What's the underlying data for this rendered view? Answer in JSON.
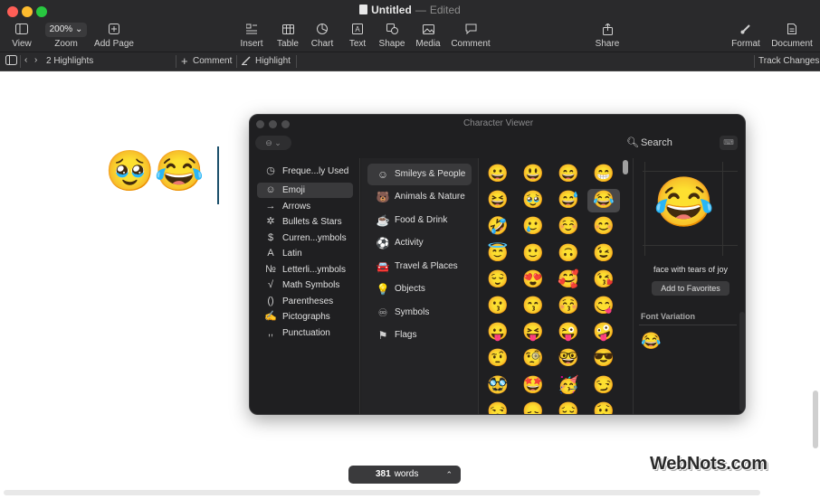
{
  "window": {
    "title": "Untitled",
    "title_sep": "—",
    "status": "Edited"
  },
  "toolbar": {
    "view": "View",
    "zoom_value": "200% ⌄",
    "zoom": "Zoom",
    "add_page": "Add Page",
    "insert": "Insert",
    "table": "Table",
    "chart": "Chart",
    "text": "Text",
    "shape": "Shape",
    "media": "Media",
    "comment": "Comment",
    "share": "Share",
    "format": "Format",
    "document": "Document"
  },
  "formatbar": {
    "highlights": "2 Highlights",
    "comment": "Comment",
    "highlight": "Highlight",
    "track_changes": "Track Changes"
  },
  "document": {
    "emoji_text": "🥹😂",
    "word_count": "381",
    "word_label": "words",
    "watermark": "WebNots.com"
  },
  "character_viewer": {
    "title": "Character Viewer",
    "search": "Search",
    "categories": [
      {
        "icon": "◷",
        "label": "Freque...ly Used"
      },
      {
        "icon": "☺",
        "label": "Emoji"
      },
      {
        "icon": "→",
        "label": "Arrows"
      },
      {
        "icon": "✲",
        "label": "Bullets & Stars"
      },
      {
        "icon": "$",
        "label": "Curren...ymbols"
      },
      {
        "icon": "A",
        "label": "Latin"
      },
      {
        "icon": "№",
        "label": "Letterli...ymbols"
      },
      {
        "icon": "√",
        "label": "Math Symbols"
      },
      {
        "icon": "()",
        "label": "Parentheses"
      },
      {
        "icon": "✍",
        "label": "Pictographs"
      },
      {
        "icon": ",,",
        "label": "Punctuation"
      }
    ],
    "emoji_categories": [
      {
        "icon": "☺",
        "label": "Smileys & People"
      },
      {
        "icon": "🐻",
        "label": "Animals & Nature"
      },
      {
        "icon": "☕",
        "label": "Food & Drink"
      },
      {
        "icon": "⚽",
        "label": "Activity"
      },
      {
        "icon": "🚘",
        "label": "Travel & Places"
      },
      {
        "icon": "💡",
        "label": "Objects"
      },
      {
        "icon": "♾",
        "label": "Symbols"
      },
      {
        "icon": "⚑",
        "label": "Flags"
      }
    ],
    "emoji_grid": [
      [
        "😀",
        "😃",
        "😄",
        "😁"
      ],
      [
        "😆",
        "🥹",
        "😅",
        "😂"
      ],
      [
        "🤣",
        "🥲",
        "☺️",
        "😊"
      ],
      [
        "😇",
        "🙂",
        "🙃",
        "😉"
      ],
      [
        "😌",
        "😍",
        "🥰",
        "😘"
      ],
      [
        "😗",
        "😙",
        "😚",
        "😋"
      ],
      [
        "😛",
        "😝",
        "😜",
        "🤪"
      ],
      [
        "🤨",
        "🧐",
        "🤓",
        "😎"
      ],
      [
        "🥸",
        "🤩",
        "🥳",
        "😏"
      ],
      [
        "😒",
        "😞",
        "😔",
        "😟"
      ]
    ],
    "selected_emoji": "😂",
    "selected_name": "face with tears of joy",
    "add_favorites": "Add to Favorites",
    "font_variation": "Font Variation",
    "variation_emoji": "😂"
  }
}
